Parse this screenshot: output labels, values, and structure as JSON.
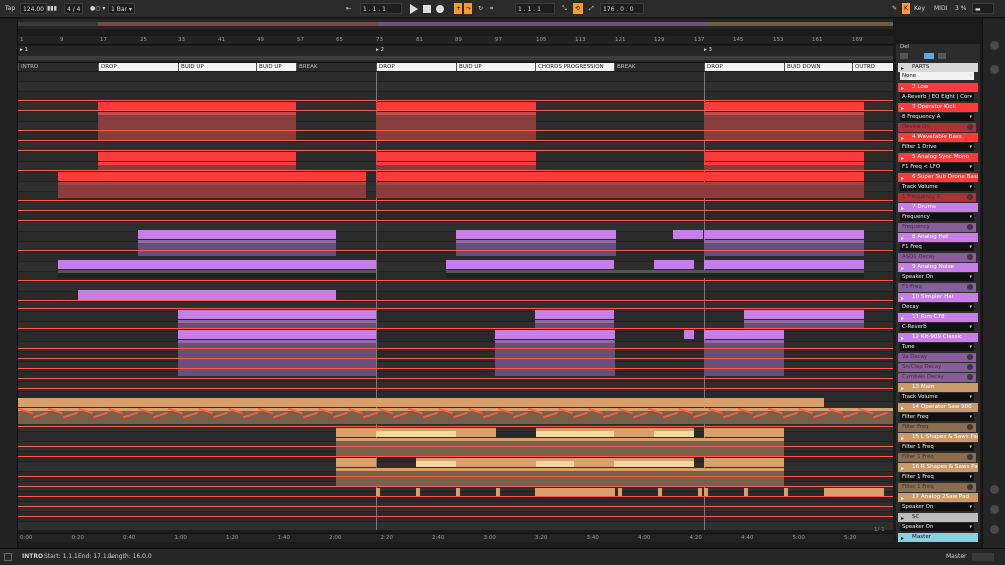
{
  "transport": {
    "tap_label": "Tap",
    "tempo": "124.00",
    "sig": "4 / 4",
    "metro": "●○ ▾",
    "quant": "1 Bar ▾",
    "pos1": "1 .  1 .  1",
    "pos2": "1 .  1 .  1",
    "end": "176 .  0 .  0",
    "key_label": "Key",
    "midi_label": "MIDI",
    "cpu": "3 %"
  },
  "ruler_ticks": [
    "1",
    "9",
    "17",
    "25",
    "33",
    "41",
    "49",
    "57",
    "65",
    "73",
    "81",
    "89",
    "97",
    "105",
    "113",
    "121",
    "129",
    "137",
    "145",
    "153",
    "161",
    "169"
  ],
  "scene_markers": [
    "1",
    "2",
    "3"
  ],
  "locators": [
    "INTRO",
    "DROP",
    "BUID UP",
    "BUID UP",
    "BREAK",
    "DROP",
    "BUID UP",
    "CHORDS PROGRESSION",
    "BREAK",
    "DROP",
    "BUID DOWN",
    "OUTRO"
  ],
  "time_ticks": [
    "0:00",
    "0:20",
    "0:40",
    "1:00",
    "1:20",
    "1:40",
    "2:00",
    "2:20",
    "2:40",
    "3:00",
    "3:20",
    "3:40",
    "4:00",
    "4:20",
    "4:40",
    "5:00",
    "5:20"
  ],
  "status": {
    "clip": "INTRO",
    "start": "Start: 1.1.1",
    "end": "End: 17.1.1",
    "length": "Length: 16.0.0",
    "master": "Master"
  },
  "panel": {
    "del_label": "Del",
    "fraction": "1/ 1",
    "parts_label": "PARTS",
    "parts_select": "None"
  },
  "tracks": [
    {
      "name": "2 Low",
      "color": "#ff3a3a",
      "param": "A-Reverb | EQ Eight | Cor"
    },
    {
      "name": "3 Operator Kick",
      "color": "#ff3a3a",
      "param": "8 Frequency A",
      "param2": "Device On"
    },
    {
      "name": "4 Wavetable Bass",
      "color": "#ff3a3a",
      "param": "Filter 1 Drive"
    },
    {
      "name": "5 Analog Sync Mono",
      "color": "#ff3a3a",
      "param": "F1 Freq < LFO"
    },
    {
      "name": "6 Super Sub Drone Bass",
      "color": "#ff3a3a",
      "param": "Track Volume",
      "param2": "1 Frequency A"
    },
    {
      "name": "7 Drums",
      "color": "#c77ee6",
      "param": "Frequency",
      "param2": "Frequency"
    },
    {
      "name": "8 Analog Hat",
      "color": "#c77ee6",
      "param": "F1 Freq",
      "param2": "ASD1 Decay"
    },
    {
      "name": "9 Analog Noise",
      "color": "#c77ee6",
      "param": "Speaker On",
      "param2": "F1 Freq"
    },
    {
      "name": "10 Simpler Hat",
      "color": "#c77ee6",
      "param": "Decay"
    },
    {
      "name": "11 Rim C78",
      "color": "#c77ee6",
      "param": "C-Reverb"
    },
    {
      "name": "12 Kit-909 Classic",
      "color": "#c77ee6",
      "param": "Tune",
      "param2": "Va Decay",
      "param3": "Sn/Clap Decay",
      "param4": "Cymbals Decay"
    },
    {
      "name": "13 Main",
      "color": "#c99a6a",
      "param": "Track Volume"
    },
    {
      "name": "14 Operator Saw 900",
      "color": "#c99a6a",
      "param": "Filter Freq",
      "param2": "Filter Freq"
    },
    {
      "name": "15 L Shapes & Saws Pad",
      "color": "#c99a6a",
      "param": "Filter 1 Freq",
      "param2": "Filter 1 Freq"
    },
    {
      "name": "16 R Shapes & Saws Pad",
      "color": "#c99a6a",
      "param": "Filter 1 Freq",
      "param2": "Filter 1 Freq"
    },
    {
      "name": "17 Analog 2Saw Pad",
      "color": "#c99a6a",
      "param": "Speaker On"
    },
    {
      "name": "SC",
      "color": "#bdbdbd",
      "param": "Speaker On"
    },
    {
      "name": "Master",
      "color": "#8fd0e0"
    }
  ],
  "colors": {
    "red": "#ff3a3a",
    "purple": "#c77ee6",
    "tan": "#d8a06a",
    "cream": "#f0d8a0",
    "accent": "#f39c3b",
    "auto": "#ff5a4a"
  }
}
